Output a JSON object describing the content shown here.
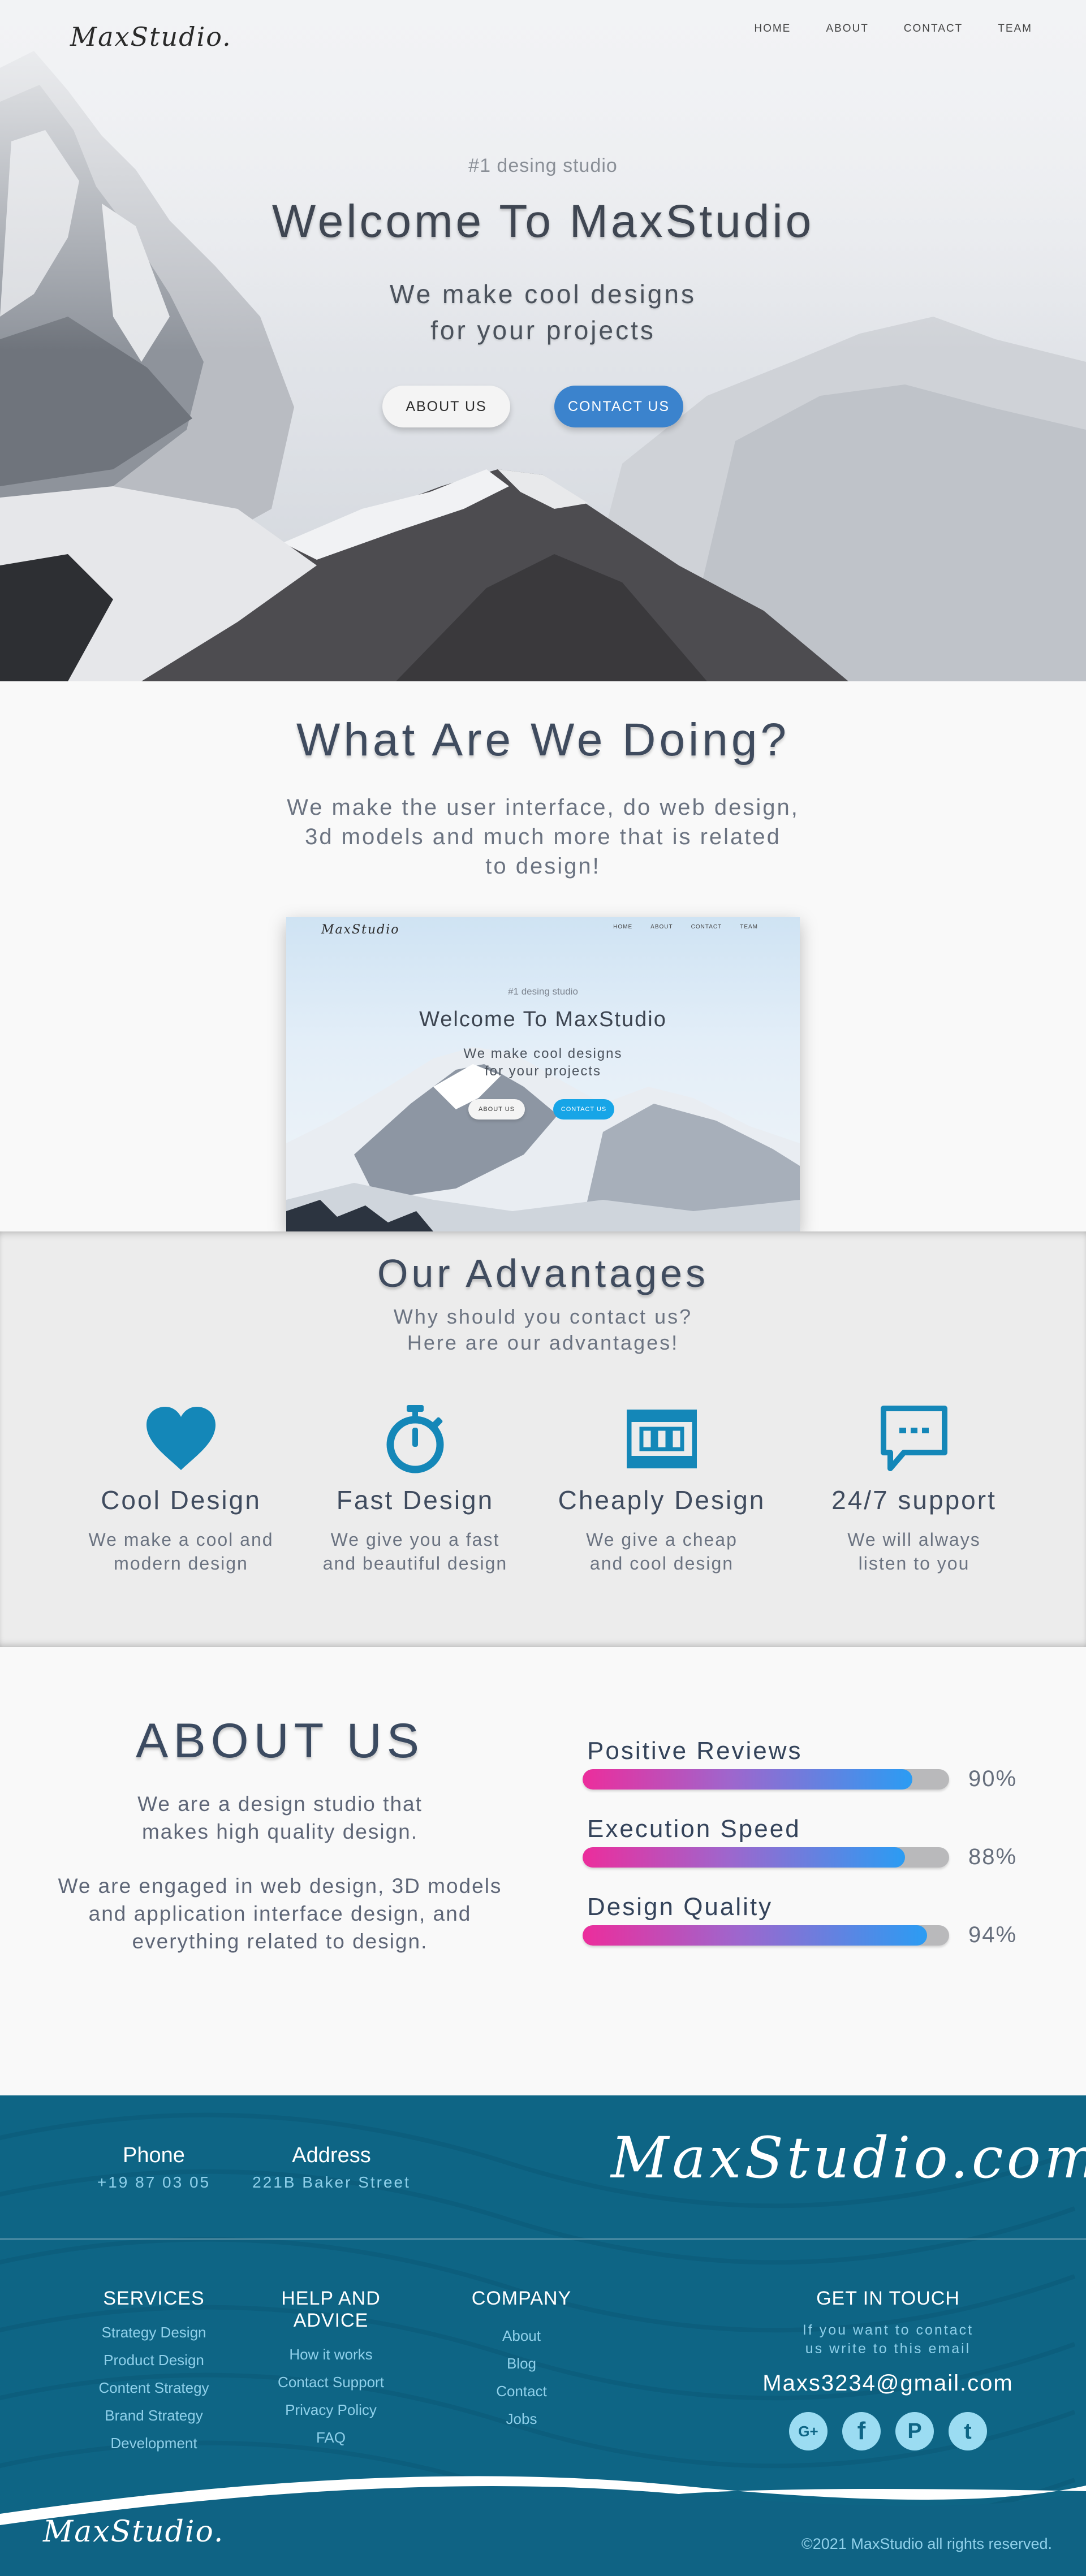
{
  "header": {
    "logo": "MaxStudio.",
    "nav": [
      "HOME",
      "ABOUT",
      "CONTACT",
      "TEAM"
    ]
  },
  "hero": {
    "kicker": "#1 desing studio",
    "title": "Welcome To MaxStudio",
    "subtitle_line1": "We make cool designs",
    "subtitle_line2": "for your projects",
    "about_button": "ABOUT US",
    "contact_button": "CONTACT US"
  },
  "doing": {
    "title": "What Are We Doing?",
    "desc_line1": "We make the user interface, do web design,",
    "desc_line2": "3d models and much more that is related",
    "desc_line3": "to design!"
  },
  "preview": {
    "logo": "MaxStudio",
    "nav": [
      "HOME",
      "ABOUT",
      "CONTACT",
      "TEAM"
    ],
    "kicker": "#1 desing studio",
    "title": "Welcome To MaxStudio",
    "sub_line1": "We make cool designs",
    "sub_line2": "for your projects",
    "about_button": "ABOUT US",
    "contact_button": "CONTACT US"
  },
  "advantages": {
    "title": "Our Advantages",
    "sub_line1": "Why should you contact us?",
    "sub_line2": "Here are our advantages!",
    "icon_color": "#1487b8",
    "items": [
      {
        "icon": "heart-icon",
        "name": "Cool Design",
        "desc1": "We make a cool and",
        "desc2": "modern design"
      },
      {
        "icon": "stopwatch-icon",
        "name": "Fast Design",
        "desc1": "We give you a fast",
        "desc2": "and beautiful design"
      },
      {
        "icon": "money-bill-icon",
        "name": "Cheaply Design",
        "desc1": "We give a cheap",
        "desc2": "and cool design"
      },
      {
        "icon": "chat-bubble-icon",
        "name": "24/7 support",
        "desc1": "We will always",
        "desc2": "listen to you"
      }
    ]
  },
  "about": {
    "title": "ABOUT US",
    "p1_line1": "We are a design studio that",
    "p1_line2": "makes high quality design.",
    "p2_line1": "We are engaged in web design, 3D models",
    "p2_line2": "and application interface design, and",
    "p2_line3": "everything related to design.",
    "skills": [
      {
        "label": "Positive Reviews",
        "percent_text": "90%",
        "value": 0.9
      },
      {
        "label": "Execution Speed",
        "percent_text": "88%",
        "value": 0.88
      },
      {
        "label": "Design Quality",
        "percent_text": "94%",
        "value": 0.94
      }
    ]
  },
  "footer": {
    "phone_label": "Phone",
    "phone_value": "+19 87 03 05",
    "address_label": "Address",
    "address_value": "221B Baker Street",
    "brand": "MaxStudio.com",
    "columns": [
      {
        "heading": "SERVICES",
        "links": [
          "Strategy Design",
          "Product Design",
          "Content Strategy",
          "Brand Strategy",
          "Development"
        ]
      },
      {
        "heading": "HELP AND ADVICE",
        "links": [
          "How it works",
          "Contact Support",
          "Privacy Policy",
          "FAQ"
        ]
      },
      {
        "heading": "COMPANY",
        "links": [
          "About",
          "Blog",
          "Contact",
          "Jobs"
        ]
      }
    ],
    "touch_heading": "GET IN TOUCH",
    "touch_line1": "If you want to contact",
    "touch_line2": "us write to this email",
    "email": "Maxs3234@gmail.com",
    "socials": [
      {
        "icon": "google-plus-icon",
        "glyph": "G+"
      },
      {
        "icon": "facebook-icon",
        "glyph": "f"
      },
      {
        "icon": "pinterest-icon",
        "glyph": "P"
      },
      {
        "icon": "twitter-icon",
        "glyph": "t"
      }
    ],
    "logo": "MaxStudio.",
    "copyright": "©2021 MaxStudio all rights reserved."
  }
}
